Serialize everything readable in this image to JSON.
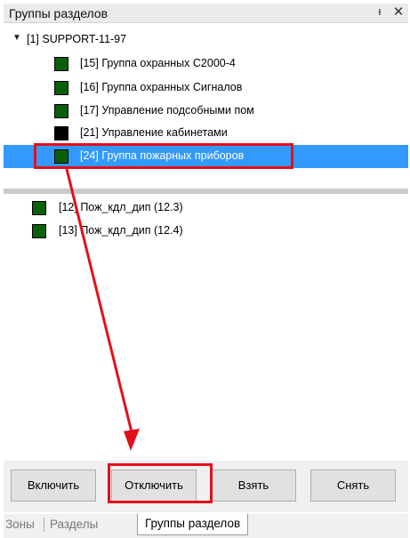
{
  "window": {
    "title": "Группы разделов",
    "pin_glyph": "ᵻ",
    "close_glyph": "✕"
  },
  "tree": {
    "root": {
      "label": "[1] SUPPORT-11-97",
      "expanded": true
    },
    "groups": [
      {
        "label": "[15] Группа охранных С2000-4",
        "color": "#0a5f0a"
      },
      {
        "label": "[16] Группа охранных Сигналов",
        "color": "#0a5f0a"
      },
      {
        "label": "[17] Управление подсобными пом",
        "color": "#0a5f0a"
      },
      {
        "label": "[21] Управление кабинетами",
        "color": "#000000"
      },
      {
        "label": "[24] Группа пожарных приборов",
        "color": "#0a5f0a",
        "selected": true
      }
    ]
  },
  "zones": [
    {
      "label": "[12] Пож_кдл_дип (12.3)",
      "color": "#0a5f0a"
    },
    {
      "label": "[13] Пож_кдл_дип (12.4)",
      "color": "#0a5f0a"
    }
  ],
  "buttons": {
    "enable": "Включить",
    "disable": "Отключить",
    "arm": "Взять",
    "disarm": "Снять"
  },
  "tabs": [
    {
      "label": "Зоны",
      "active": false
    },
    {
      "label": "Разделы",
      "active": false
    },
    {
      "label": "Группы разделов",
      "active": true
    }
  ],
  "colors": {
    "selection": "#3399ff",
    "annotation_red": "#e3101a",
    "status_green": "#0a5f0a"
  }
}
